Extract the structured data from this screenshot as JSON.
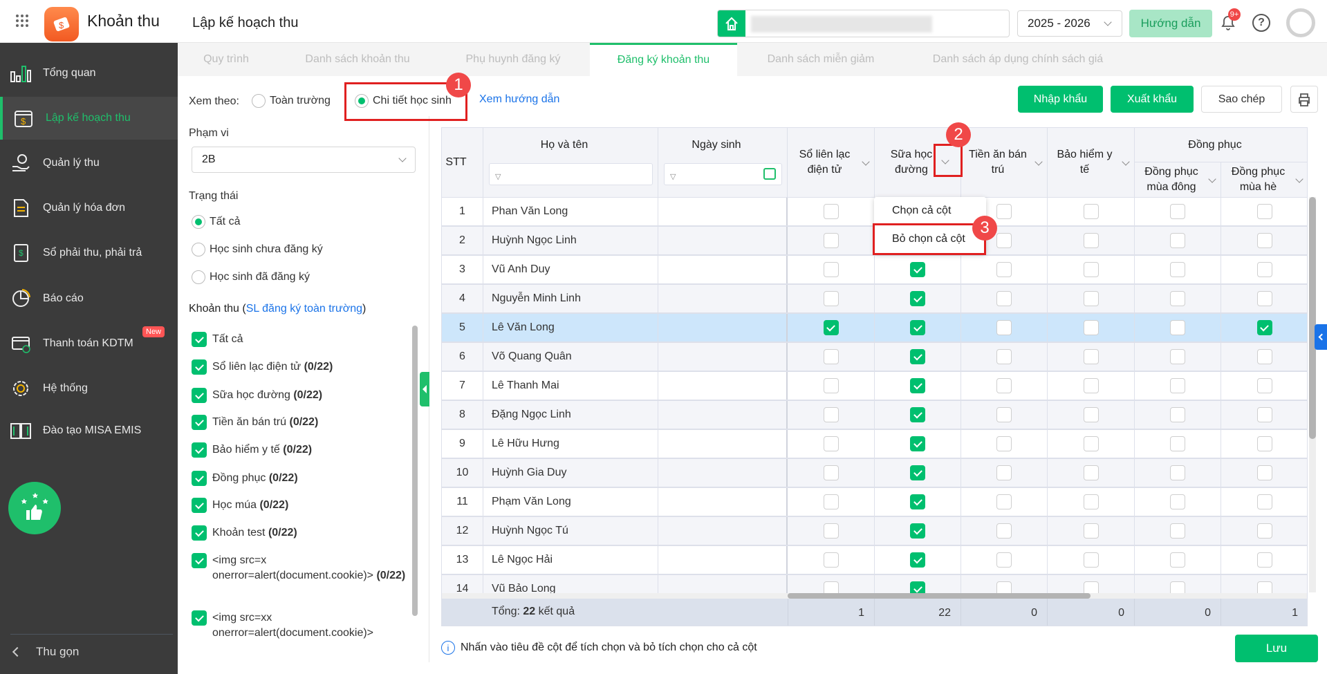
{
  "header": {
    "app_name": "Khoản thu",
    "page_title": "Lập kế hoạch thu",
    "school_year": "2025 - 2026",
    "guide_button": "Hướng dẫn",
    "notification_count": "9+"
  },
  "sidebar": {
    "items": [
      {
        "label": "Tổng quan",
        "icon": "bar-chart-icon"
      },
      {
        "label": "Lập kế hoạch thu",
        "icon": "calendar-dollar-icon",
        "active": true
      },
      {
        "label": "Quản lý thu",
        "icon": "hand-money-icon"
      },
      {
        "label": "Quản lý hóa đơn",
        "icon": "invoice-icon"
      },
      {
        "label": "Sổ phải thu, phải trả",
        "icon": "ledger-icon"
      },
      {
        "label": "Báo cáo",
        "icon": "pie-chart-icon"
      },
      {
        "label": "Thanh toán KDTM",
        "icon": "payment-card-icon",
        "badge": "New"
      },
      {
        "label": "Hệ thống",
        "icon": "gear-icon"
      },
      {
        "label": "Đào tạo MISA EMIS",
        "icon": "book-icon"
      }
    ],
    "collapse_label": "Thu gọn"
  },
  "tabs": [
    "Quy trình",
    "Danh sách khoản thu",
    "Phụ huynh đăng ký",
    "Đăng ký khoản thu",
    "Danh sách miễn giảm",
    "Danh sách áp dụng chính sách giá"
  ],
  "filters": {
    "view_label": "Xem theo:",
    "view_options": [
      "Toàn trường",
      "Chi tiết học sinh"
    ],
    "view_selected": "Chi tiết học sinh",
    "guide_link": "Xem hướng dẫn",
    "scope_label": "Phạm vi",
    "scope_value": "2B",
    "status_label": "Trạng thái",
    "status_options": [
      "Tất cả",
      "Học sinh chưa đăng ký",
      "Học sinh đã đăng ký"
    ],
    "status_selected": "Tất cả",
    "fees_label": "Khoản thu (",
    "fees_link": "SL đăng ký toàn trường",
    "fees_label_end": ")",
    "fees": [
      {
        "name": "Tất cả",
        "count": ""
      },
      {
        "name": "Sổ liên lạc điện tử ",
        "count": "(0/22)"
      },
      {
        "name": "Sữa học đường ",
        "count": "(0/22)"
      },
      {
        "name": "Tiền ăn bán trú ",
        "count": "(0/22)"
      },
      {
        "name": "Bảo hiểm y tế ",
        "count": "(0/22)"
      },
      {
        "name": "Đồng phục ",
        "count": "(0/22)"
      },
      {
        "name": "Học múa ",
        "count": "(0/22)"
      },
      {
        "name": "Khoản test ",
        "count": "(0/22)"
      },
      {
        "name": "<img src=x onerror=alert(document.cookie)> ",
        "count": "(0/22)"
      },
      {
        "name": "<img src=xx onerror=alert(document.cookie)>",
        "count": ""
      }
    ]
  },
  "toolbar": {
    "import": "Nhập khẩu",
    "export": "Xuất khẩu",
    "copy": "Sao chép"
  },
  "table": {
    "headers": {
      "stt": "STT",
      "name": "Họ và tên",
      "dob": "Ngày sinh",
      "fee_cols": [
        "Sổ liên lạc điện tử",
        "Sữa học đường",
        "Tiền ăn bán trú",
        "Bảo hiểm y tế"
      ],
      "group": "Đồng phục",
      "group_cols": [
        "Đồng phục mùa đông",
        "Đồng phục mùa hè"
      ]
    },
    "rows": [
      {
        "stt": "1",
        "name": "Phan Văn Long",
        "checks": [
          0,
          0,
          0,
          0,
          0,
          0
        ]
      },
      {
        "stt": "2",
        "name": "Huỳnh Ngọc Linh",
        "checks": [
          0,
          0,
          0,
          0,
          0,
          0
        ]
      },
      {
        "stt": "3",
        "name": "Vũ Anh Duy",
        "checks": [
          0,
          1,
          0,
          0,
          0,
          0
        ]
      },
      {
        "stt": "4",
        "name": "Nguyễn Minh Linh",
        "checks": [
          0,
          1,
          0,
          0,
          0,
          0
        ]
      },
      {
        "stt": "5",
        "name": "Lê Văn Long",
        "checks": [
          1,
          1,
          0,
          0,
          0,
          1
        ],
        "selected": true
      },
      {
        "stt": "6",
        "name": "Võ Quang Quân",
        "checks": [
          0,
          1,
          0,
          0,
          0,
          0
        ]
      },
      {
        "stt": "7",
        "name": "Lê Thanh Mai",
        "checks": [
          0,
          1,
          0,
          0,
          0,
          0
        ]
      },
      {
        "stt": "8",
        "name": "Đặng Ngọc Linh",
        "checks": [
          0,
          1,
          0,
          0,
          0,
          0
        ]
      },
      {
        "stt": "9",
        "name": "Lê Hữu Hưng",
        "checks": [
          0,
          1,
          0,
          0,
          0,
          0
        ]
      },
      {
        "stt": "10",
        "name": "Huỳnh Gia Duy",
        "checks": [
          0,
          1,
          0,
          0,
          0,
          0
        ]
      },
      {
        "stt": "11",
        "name": "Phạm Văn Long",
        "checks": [
          0,
          1,
          0,
          0,
          0,
          0
        ]
      },
      {
        "stt": "12",
        "name": "Huỳnh Ngọc Tú",
        "checks": [
          0,
          1,
          0,
          0,
          0,
          0
        ]
      },
      {
        "stt": "13",
        "name": "Lê Ngọc Hải",
        "checks": [
          0,
          1,
          0,
          0,
          0,
          0
        ]
      },
      {
        "stt": "14",
        "name": "Vũ Bảo Long",
        "checks": [
          0,
          1,
          0,
          0,
          0,
          0
        ]
      }
    ],
    "total_prefix": "Tổng: ",
    "total_count": "22",
    "total_suffix": " kết quả",
    "totals": [
      "1",
      "22",
      "0",
      "0",
      "0",
      "1"
    ]
  },
  "column_menu": {
    "items": [
      "Chọn cả cột",
      "Bỏ chọn cả cột"
    ]
  },
  "annotations": [
    "1",
    "2",
    "3"
  ],
  "hint": "Nhấn vào tiêu đề cột để tích chọn và bỏ tích chọn cho cả cột",
  "save_button": "Lưu",
  "colors": {
    "accent": "#00bf6f",
    "sidebar": "#3b3b3b",
    "selected_row": "#cde6fb",
    "annotation": "#f04848"
  }
}
